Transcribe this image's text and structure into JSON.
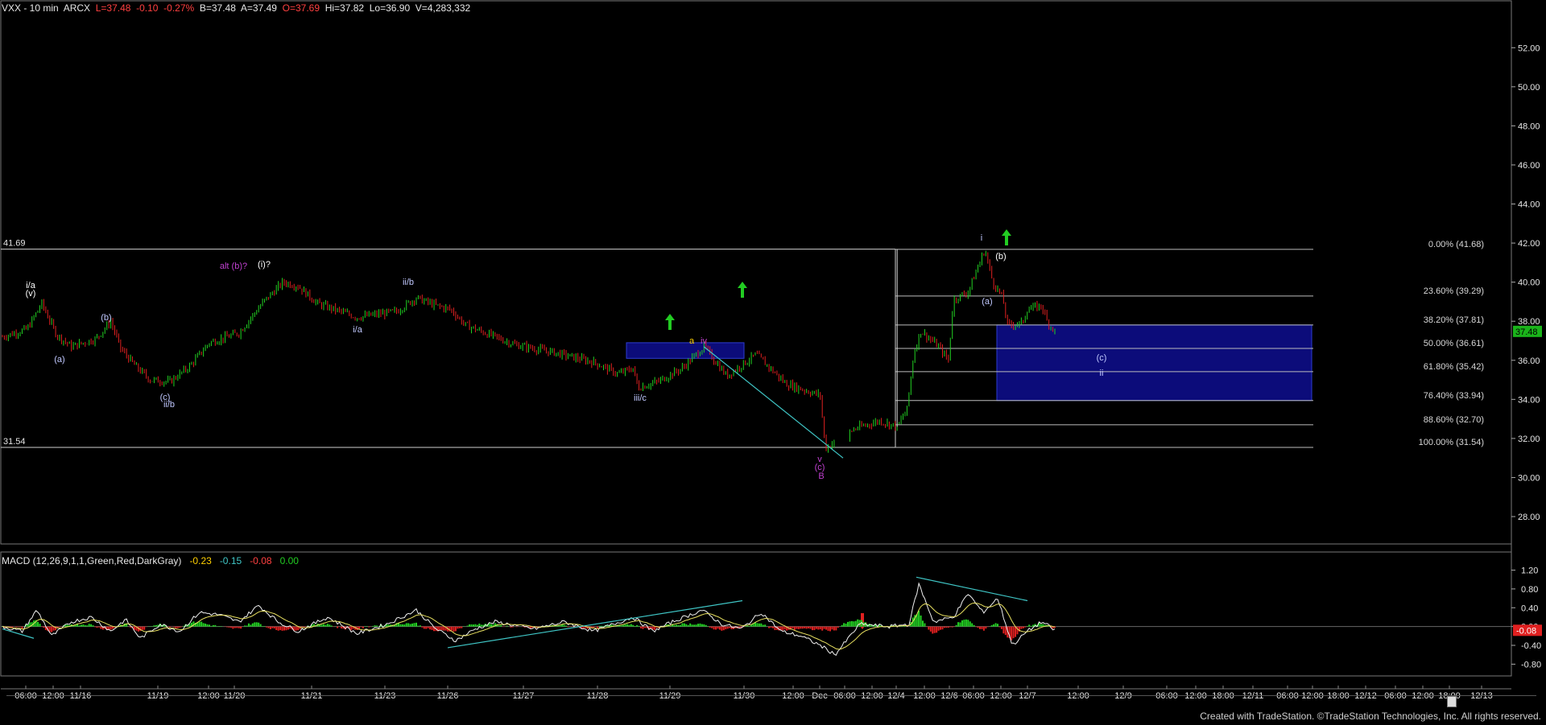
{
  "header": {
    "symbol": "VXX - 10 min",
    "exchange": "ARCX",
    "last": "L=37.48",
    "change": "-0.10",
    "change_pct": "-0.27%",
    "bid": "B=37.48",
    "ask": "A=37.49",
    "open": "O=37.69",
    "high": "Hi=37.82",
    "low": "Lo=36.90",
    "volume": "V=4,283,332"
  },
  "macd_header": {
    "label": "MACD (12,26,9,1,1,Green,Red,DarkGray)",
    "v1": "-0.23",
    "v2": "-0.15",
    "v3": "-0.08",
    "v4": "0.00"
  },
  "credit": "Created with TradeStation. ©TradeStation Technologies, Inc. All rights reserved.",
  "colors": {
    "up": "#22d122",
    "down": "#e02020",
    "text": "#e6e6e6",
    "purple": "#c040d0",
    "green": "#22cc22",
    "teal": "#3fc6c6",
    "box": "#0c0c7a",
    "box_edge": "#2c3cd0",
    "label_bg": "#1ab41a"
  },
  "chart_data": {
    "type": "candlestick",
    "price_axis": {
      "ticks": [
        28.0,
        30.0,
        32.0,
        34.0,
        36.0,
        38.0,
        40.0,
        42.0,
        44.0,
        46.0,
        48.0,
        50.0,
        52.0
      ],
      "ylim": [
        26.6,
        53.7
      ],
      "last_price": "37.48"
    },
    "time_axis": {
      "labels": [
        "06:00",
        "12:00",
        "11/16",
        "11/19",
        "12:00",
        "11/20",
        "11/21",
        "11/23",
        "11/26",
        "11/27",
        "11/28",
        "11/29",
        "11/30",
        "12:00",
        "Dec",
        "06:00",
        "12:00",
        "12/4",
        "12:00",
        "12/6",
        "06:00",
        "12:00",
        "12/7",
        "12:00",
        "12/9",
        "06:00",
        "12:00",
        "18:00",
        "12/11",
        "06:00",
        "12:00",
        "18:00",
        "12/12",
        "06:00",
        "12:00",
        "18:00",
        "12/13"
      ]
    },
    "price_path": [
      [
        0,
        37.2
      ],
      [
        25,
        37.6
      ],
      [
        40,
        38.9
      ],
      [
        55,
        37.3
      ],
      [
        70,
        36.7
      ],
      [
        95,
        37.1
      ],
      [
        110,
        38.0
      ],
      [
        120,
        36.6
      ],
      [
        135,
        35.7
      ],
      [
        150,
        35.0
      ],
      [
        170,
        34.9
      ],
      [
        190,
        35.7
      ],
      [
        210,
        36.9
      ],
      [
        240,
        37.4
      ],
      [
        265,
        39.0
      ],
      [
        285,
        40.0
      ],
      [
        300,
        39.8
      ],
      [
        320,
        38.9
      ],
      [
        360,
        38.2
      ],
      [
        400,
        38.5
      ],
      [
        420,
        39.2
      ],
      [
        440,
        38.8
      ],
      [
        455,
        38.6
      ],
      [
        470,
        37.8
      ],
      [
        520,
        36.8
      ],
      [
        560,
        36.4
      ],
      [
        600,
        35.9
      ],
      [
        625,
        35.3
      ],
      [
        640,
        35.6
      ],
      [
        645,
        34.6
      ],
      [
        665,
        34.9
      ],
      [
        690,
        35.6
      ],
      [
        712,
        36.7
      ],
      [
        735,
        35.2
      ],
      [
        765,
        36.3
      ],
      [
        795,
        34.8
      ],
      [
        830,
        34.2
      ],
      [
        835,
        31.5
      ],
      [
        865,
        32.5
      ],
      [
        890,
        32.9
      ],
      [
        908,
        32.6
      ],
      [
        918,
        33.5
      ],
      [
        925,
        36.4
      ],
      [
        932,
        37.5
      ],
      [
        950,
        36.7
      ],
      [
        960,
        36.0
      ],
      [
        965,
        39.1
      ],
      [
        980,
        39.5
      ],
      [
        997,
        41.68
      ],
      [
        1005,
        40.0
      ],
      [
        1015,
        39.2
      ],
      [
        1020,
        37.8
      ],
      [
        1035,
        37.9
      ],
      [
        1040,
        38.6
      ],
      [
        1055,
        38.8
      ],
      [
        1060,
        38.0
      ],
      [
        1068,
        37.48
      ]
    ],
    "fib_levels": [
      {
        "label": "0.00% (41.68)",
        "value": 41.68
      },
      {
        "label": "23.60% (39.29)",
        "value": 39.29
      },
      {
        "label": "38.20% (37.81)",
        "value": 37.81
      },
      {
        "label": "50.00% (36.61)",
        "value": 36.61
      },
      {
        "label": "61.80% (35.42)",
        "value": 35.42
      },
      {
        "label": "76.40% (33.94)",
        "value": 33.94
      },
      {
        "label": "88.60% (32.70)",
        "value": 32.7
      },
      {
        "label": "100.00% (31.54)",
        "value": 31.54
      }
    ],
    "range_lines": [
      {
        "label": "41.69",
        "value": 41.69
      },
      {
        "label": "31.54",
        "value": 31.54
      }
    ],
    "target_zones": [
      {
        "from": 33.94,
        "to": 37.81
      },
      {
        "from": 36.1,
        "to": 36.9
      }
    ],
    "wave_labels": [
      {
        "text": "i/a",
        "color": "#ffffff",
        "price": 39.5
      },
      {
        "text": "(v)",
        "color": "#ffffff",
        "price": 39.0
      },
      {
        "text": "(a)",
        "color": "#c0c8ff",
        "price": 36.3
      },
      {
        "text": "(b)",
        "color": "#c0c8ff",
        "price": 38.4
      },
      {
        "text": "(c)",
        "color": "#c0c8ff",
        "price": 34.4
      },
      {
        "text": "ii/b",
        "color": "#c0c8ff",
        "price": 34.0
      },
      {
        "text": "alt (b)?",
        "color": "#c040d0",
        "price": 40.9
      },
      {
        "text": "(i)?",
        "color": "#ffffff",
        "price": 40.9
      },
      {
        "text": "i/a",
        "color": "#c0c8ff",
        "price": 37.8
      },
      {
        "text": "ii/b",
        "color": "#c0c8ff",
        "price": 39.8
      },
      {
        "text": "iii/c",
        "color": "#c0c8ff",
        "price": 34.4
      },
      {
        "text": "a",
        "color": "#ffd000",
        "price": 36.9
      },
      {
        "text": "iv",
        "color": "#c040d0",
        "price": 36.9
      },
      {
        "text": "v",
        "color": "#c040d0",
        "price": 31.2
      },
      {
        "text": "(c)",
        "color": "#c040d0",
        "price": 30.8
      },
      {
        "text": "B",
        "color": "#c040d0",
        "price": 30.2
      },
      {
        "text": "i",
        "color": "#c0c8ff",
        "price": 42.0
      },
      {
        "text": "(a)",
        "color": "#c0c8ff",
        "price": 39.0
      },
      {
        "text": "(b)",
        "color": "#ffffff",
        "price": 41.1
      },
      {
        "text": "(c)",
        "color": "#c0c8ff",
        "price": 36.0
      },
      {
        "text": "ii",
        "color": "#c0c8ff",
        "price": 35.4
      }
    ],
    "arrows": [
      {
        "direction": "up",
        "color": "#22cc22",
        "price": 37.6
      },
      {
        "direction": "up",
        "color": "#22cc22",
        "price": 39.7
      },
      {
        "direction": "up",
        "color": "#22cc22",
        "price": 42.0
      },
      {
        "direction": "down",
        "color": "#e02020",
        "price": null
      }
    ],
    "macd": {
      "ticks": [
        "1.20",
        "0.80",
        "0.40",
        "0.00",
        "-0.40",
        "-0.80"
      ],
      "ylim": [
        -1.05,
        1.38
      ],
      "last_value": "-0.08",
      "path": [
        [
          0,
          0.0
        ],
        [
          20,
          -0.1
        ],
        [
          35,
          0.35
        ],
        [
          50,
          -0.2
        ],
        [
          70,
          0.1
        ],
        [
          90,
          0.2
        ],
        [
          110,
          -0.1
        ],
        [
          125,
          0.15
        ],
        [
          140,
          -0.25
        ],
        [
          160,
          0.05
        ],
        [
          180,
          -0.1
        ],
        [
          200,
          0.3
        ],
        [
          220,
          0.25
        ],
        [
          240,
          0.1
        ],
        [
          260,
          0.45
        ],
        [
          280,
          0.1
        ],
        [
          300,
          -0.1
        ],
        [
          330,
          0.2
        ],
        [
          360,
          -0.15
        ],
        [
          390,
          0.05
        ],
        [
          420,
          0.35
        ],
        [
          440,
          -0.05
        ],
        [
          460,
          -0.3
        ],
        [
          480,
          -0.05
        ],
        [
          500,
          0.1
        ],
        [
          540,
          -0.05
        ],
        [
          570,
          0.1
        ],
        [
          600,
          -0.1
        ],
        [
          620,
          0.05
        ],
        [
          640,
          0.2
        ],
        [
          660,
          -0.1
        ],
        [
          680,
          0.1
        ],
        [
          710,
          0.35
        ],
        [
          730,
          0.05
        ],
        [
          750,
          -0.05
        ],
        [
          770,
          0.3
        ],
        [
          790,
          -0.1
        ],
        [
          810,
          -0.2
        ],
        [
          830,
          -0.4
        ],
        [
          845,
          -0.6
        ],
        [
          870,
          0.05
        ],
        [
          900,
          0.0
        ],
        [
          920,
          0.05
        ],
        [
          930,
          0.9
        ],
        [
          945,
          0.1
        ],
        [
          965,
          0.2
        ],
        [
          980,
          0.7
        ],
        [
          995,
          0.3
        ],
        [
          1010,
          0.6
        ],
        [
          1025,
          -0.4
        ],
        [
          1040,
          -0.1
        ],
        [
          1055,
          0.1
        ],
        [
          1068,
          -0.08
        ]
      ]
    }
  }
}
